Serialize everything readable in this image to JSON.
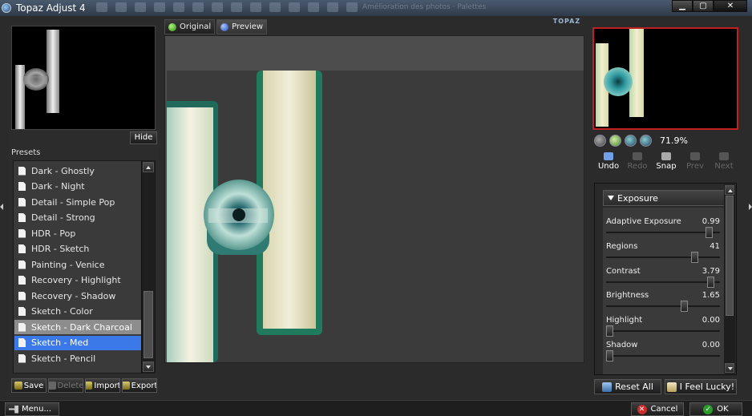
{
  "window": {
    "title": "Topaz Adjust 4",
    "taskbar_hint": "Amélioration des photos · Palettes"
  },
  "colors": {
    "selection_blue": "#3b79e8",
    "selection_grey": "#8d8d8d",
    "preview_frame": "#c12020",
    "teal": "#1f7a7a",
    "cream": "#e8e4bd"
  },
  "left": {
    "hide_label": "Hide",
    "presets_label": "Presets",
    "presets": [
      "Dark - Ghostly",
      "Dark - Night",
      "Detail - Simple Pop",
      "Detail - Strong",
      "HDR - Pop",
      "HDR - Sketch",
      "Painting - Venice",
      "Recovery - Highlight",
      "Recovery - Shadow",
      "Sketch - Color",
      "Sketch - Dark Charcoal",
      "Sketch - Med",
      "Sketch - Pencil"
    ],
    "hover_preset_index": 10,
    "selected_preset_index": 11,
    "actions": {
      "save": "Save",
      "delete": "Delete",
      "import": "Import",
      "export": "Export"
    }
  },
  "center": {
    "tabs": {
      "original": "Original",
      "preview": "Preview"
    },
    "logo_text": "TOPAZ"
  },
  "right": {
    "zoom_value": "71.9%",
    "history": {
      "undo": "Undo",
      "redo": "Redo",
      "snap": "Snap",
      "prev": "Prev",
      "next": "Next"
    },
    "section_title": "Exposure",
    "sliders": [
      {
        "name": "Adaptive Exposure",
        "value": "0.99",
        "fraction": 0.93
      },
      {
        "name": "Regions",
        "value": "41",
        "fraction": 0.8
      },
      {
        "name": "Contrast",
        "value": "3.79",
        "fraction": 0.95
      },
      {
        "name": "Brightness",
        "value": "1.65",
        "fraction": 0.7
      },
      {
        "name": "Highlight",
        "value": "0.00",
        "fraction": 0.0
      },
      {
        "name": "Shadow",
        "value": "0.00",
        "fraction": 0.0
      }
    ],
    "reset_label": "Reset All",
    "lucky_label": "I Feel Lucky!"
  },
  "bottom": {
    "menu_label": "Menu...",
    "cancel_label": "Cancel",
    "ok_label": "OK"
  }
}
